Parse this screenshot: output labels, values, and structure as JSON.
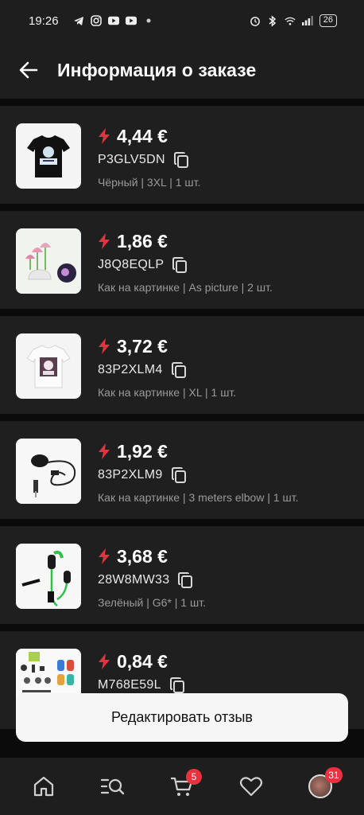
{
  "status_bar": {
    "time": "19:26",
    "battery": "26"
  },
  "header": {
    "title": "Информация о заказе"
  },
  "items": [
    {
      "price": "4,44 €",
      "code": "P3GLV5DN",
      "variant": "Чёрный | 3XL | 1 шт.",
      "image": "black-tshirt"
    },
    {
      "price": "1,86 €",
      "code": "J8Q8EQLP",
      "variant": "Как на картинке | As picture | 2 шт.",
      "image": "mushroom-lamp"
    },
    {
      "price": "3,72 €",
      "code": "83P2XLM4",
      "variant": "Как на картинке | XL | 1 шт.",
      "image": "white-tshirt"
    },
    {
      "price": "1,92 €",
      "code": "83P2XLM9",
      "variant": "Как на картинке | 3 meters elbow | 1 шт.",
      "image": "lavalier-mic"
    },
    {
      "price": "3,68 €",
      "code": "28W8MW33",
      "variant": "Зелёный | G6* | 1 шт.",
      "image": "gaming-earbuds"
    },
    {
      "price": "0,84 €",
      "code": "M768E59L",
      "variant": "",
      "image": "sticker-sheet"
    }
  ],
  "actions": {
    "edit_review": "Редактировать отзыв"
  },
  "bottom_nav": {
    "cart_badge": "5",
    "profile_badge": "31"
  },
  "colors": {
    "accent": "#e8323f",
    "background": "#0b0b0b",
    "card": "#1f1f1f"
  }
}
